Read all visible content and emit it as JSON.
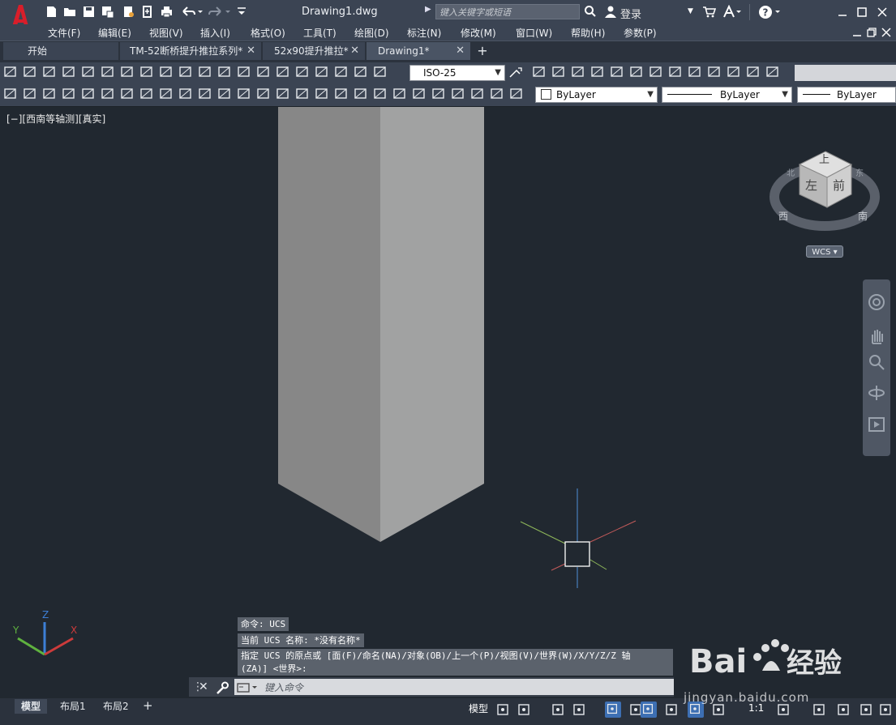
{
  "app": {
    "filename": "Drawing1.dwg",
    "search_placeholder": "键入关键字或短语",
    "login_label": "登录"
  },
  "menu": [
    "文件(F)",
    "编辑(E)",
    "视图(V)",
    "插入(I)",
    "格式(O)",
    "工具(T)",
    "绘图(D)",
    "标注(N)",
    "修改(M)",
    "窗口(W)",
    "帮助(H)",
    "参数(P)"
  ],
  "tabs": [
    {
      "label": "开始",
      "closable": false,
      "active": false
    },
    {
      "label": "TM-52断桥提升推拉系列*",
      "closable": true,
      "active": false
    },
    {
      "label": "52x90提升推拉*",
      "closable": true,
      "active": false
    },
    {
      "label": "Drawing1*",
      "closable": true,
      "active": true
    }
  ],
  "toolbar": {
    "dim_style": "ISO-25",
    "color": "ByLayer",
    "linetype": "ByLayer",
    "lineweight": "ByLayer"
  },
  "viewport": {
    "view_label": "[−][西南等轴测][真实]",
    "viewcube": {
      "top": "上",
      "front": "前",
      "left": "左",
      "compass_west": "西",
      "compass_south": "南",
      "compass_north": "北",
      "compass_east": "东"
    },
    "wcs_label": "WCS",
    "ucs_axes": {
      "x": "X",
      "y": "Y",
      "z": "Z"
    }
  },
  "command": {
    "history": [
      "命令: UCS",
      "当前 UCS 名称: *没有名称*",
      "指定 UCS 的原点或 [面(F)/命名(NA)/对象(OB)/上一个(P)/视图(V)/世界(W)/X/Y/Z/Z 轴",
      "(ZA)] <世界>:"
    ],
    "input_placeholder": "键入命令"
  },
  "status": {
    "layout_tabs": [
      "模型",
      "布局1",
      "布局2"
    ],
    "model_label": "模型",
    "scale": "1:1"
  },
  "watermark": {
    "brand": "Bai du 经验",
    "url": "jingyan.baidu.com"
  },
  "colors": {
    "background": "#212830",
    "chrome": "#3b4453",
    "accent": "#c8102e",
    "active_toggle": "#3d6fb3"
  }
}
